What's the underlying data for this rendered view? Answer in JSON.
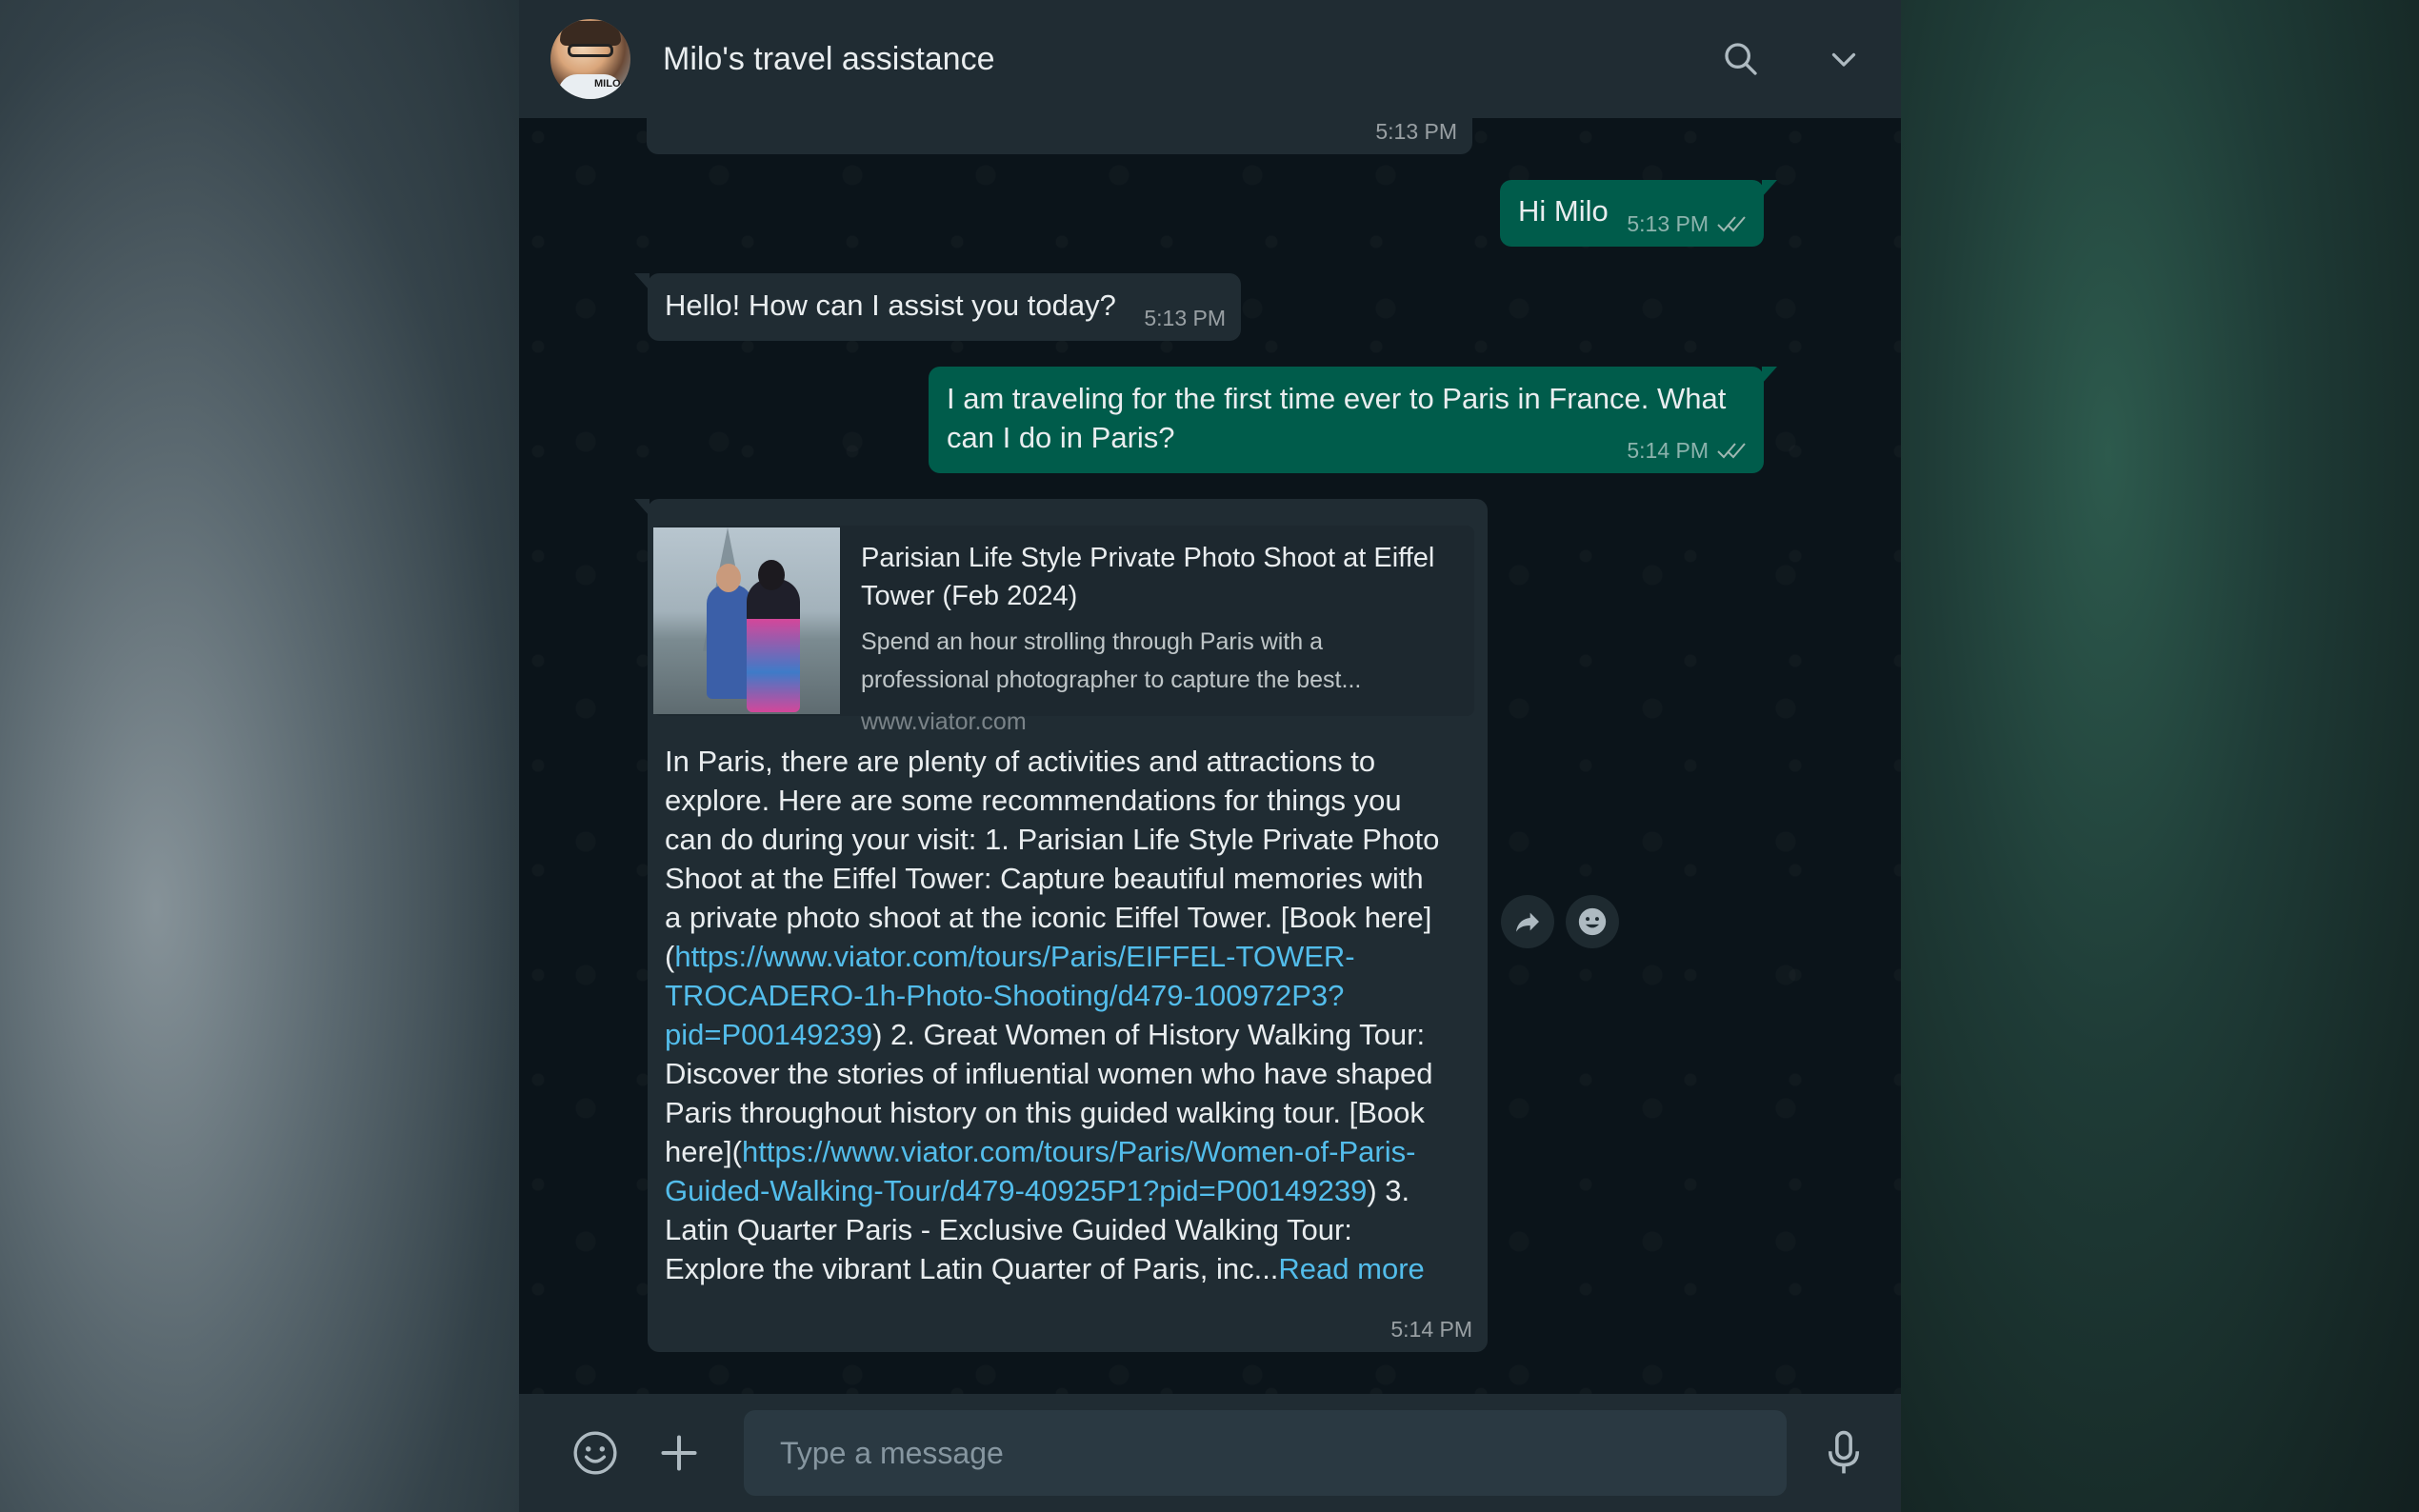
{
  "header": {
    "title": "Milo's travel assistance",
    "avatar_badge": "MILO"
  },
  "messages": [
    {
      "type": "in",
      "text": "",
      "time": "5:13 PM"
    },
    {
      "type": "out",
      "text": "Hi Milo",
      "time": "5:13 PM"
    },
    {
      "type": "in",
      "text": "Hello! How can I assist you today?",
      "time": "5:13 PM"
    },
    {
      "type": "out",
      "text_line1": "I am traveling for the first time ever to Paris in France. What",
      "text_line2": "can I do in Paris?",
      "time": "5:14 PM"
    },
    {
      "type": "in",
      "preview": {
        "title_line1": "Parisian Life Style Private Photo Shoot at Eiffel",
        "title_line2": "Tower (Feb 2024)",
        "desc_line1": "Spend an hour strolling through Paris with a",
        "desc_line2": "professional photographer to capture the best...",
        "url": "www.viator.com"
      },
      "body": {
        "l1": "In Paris, there are plenty of activities and attractions to",
        "l2": "explore. Here are some recommendations for things you",
        "l3": "can do during your visit: 1. Parisian Life Style Private Photo",
        "l4": "Shoot at the Eiffel Tower: Capture beautiful memories with",
        "l5": "a private photo shoot at the iconic Eiffel Tower. [Book here]",
        "l6_pre": "(",
        "l6_link": "https://www.viator.com/tours/Paris/EIFFEL-TOWER-",
        "l7_link": "TROCADERO-1h-Photo-Shooting/d479-100972P3?",
        "l8_link": "pid=P00149239",
        "l8_post": ") 2. Great Women of History Walking Tour:",
        "l9": "Discover the stories of influential women who have shaped",
        "l10": "Paris throughout history on this guided walking tour. [Book",
        "l11_pre": "here](",
        "l11_link": "https://www.viator.com/tours/Paris/Women-of-Paris-",
        "l12_link": "Guided-Walking-Tour/d479-40925P1?pid=P00149239",
        "l12_post": ") 3.",
        "l13": "Latin Quarter Paris - Exclusive Guided Walking Tour:",
        "l14_pre": "Explore the vibrant Latin Quarter of Paris, inc...",
        "read_more": "Read more"
      },
      "time": "5:14 PM"
    }
  ],
  "composer": {
    "placeholder": "Type a message"
  },
  "icons": [
    "search-icon",
    "chevron-down-icon",
    "forward-icon",
    "emoji-react-icon",
    "emoji-icon",
    "plus-icon",
    "microphone-icon",
    "double-check-icon"
  ],
  "colors": {
    "header_bg": "#202c33",
    "chat_bg": "#0b141a",
    "incoming_bubble": "#202c33",
    "outgoing_bubble": "#005c4b",
    "link": "#53bdeb"
  }
}
